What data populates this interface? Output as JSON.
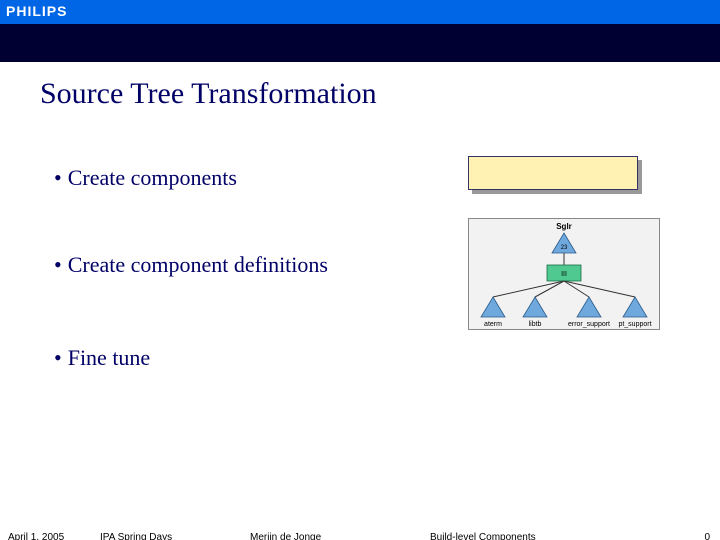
{
  "brand": {
    "logo": "PHILIPS"
  },
  "title": "Source Tree Transformation",
  "bullets": [
    "Create components",
    "Create component definitions",
    "Fine tune"
  ],
  "diagram": {
    "root_label": "Sglr",
    "mid_label_top": "23",
    "mid_label_center": "III",
    "leaves": [
      "aterm",
      "libtb",
      "error_support",
      "pt_support"
    ]
  },
  "footer": {
    "date": "April 1, 2005",
    "event": "IPA Spring Days",
    "author": "Merijn de Jonge",
    "topic": "Build-level Components",
    "page": "0"
  }
}
